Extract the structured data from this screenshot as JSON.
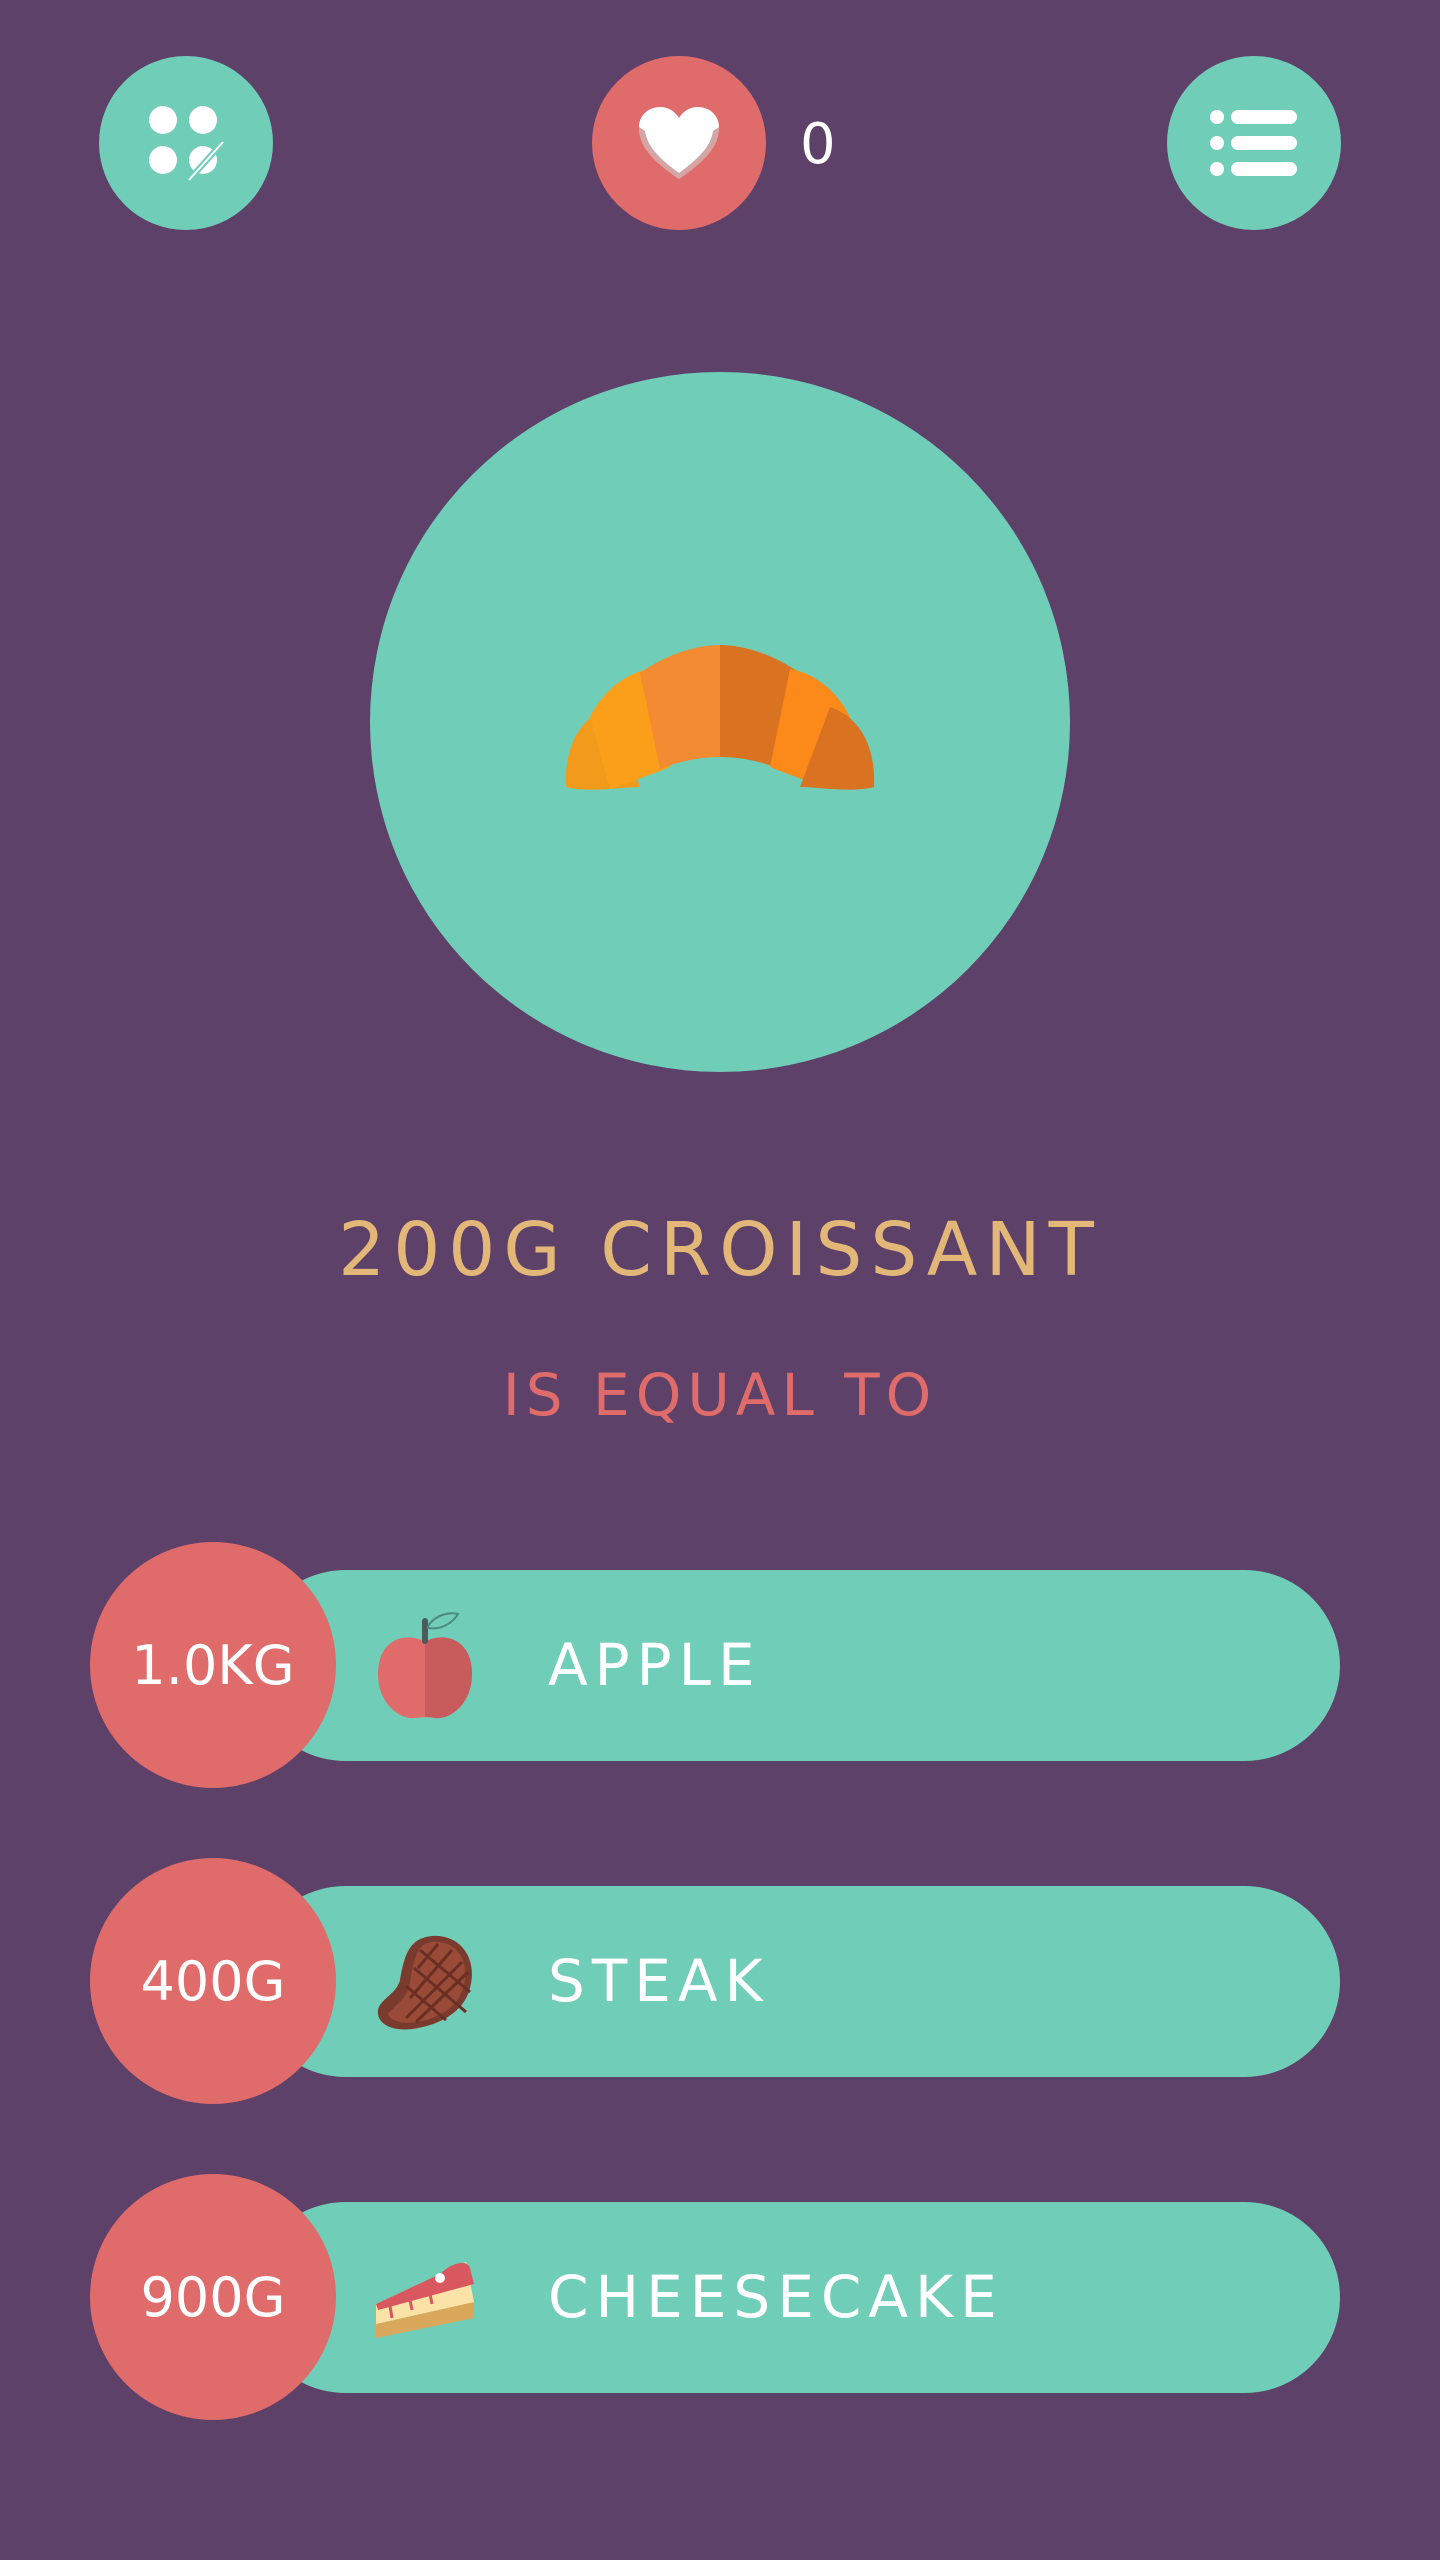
{
  "header": {
    "likes_count": "0"
  },
  "question": {
    "headline": "200G CROISSANT",
    "subline": "IS EQUAL TO"
  },
  "options": [
    {
      "weight": "1.0KG",
      "label": "APPLE",
      "icon": "apple-icon"
    },
    {
      "weight": "400G",
      "label": "STEAK",
      "icon": "steak-icon"
    },
    {
      "weight": "900G",
      "label": "CHEESECAKE",
      "icon": "cheesecake-icon"
    }
  ],
  "colors": {
    "background": "#5e4169",
    "teal": "#70cdb8",
    "coral": "#e06b6b",
    "gold": "#e3b778",
    "white": "#ffffff"
  }
}
